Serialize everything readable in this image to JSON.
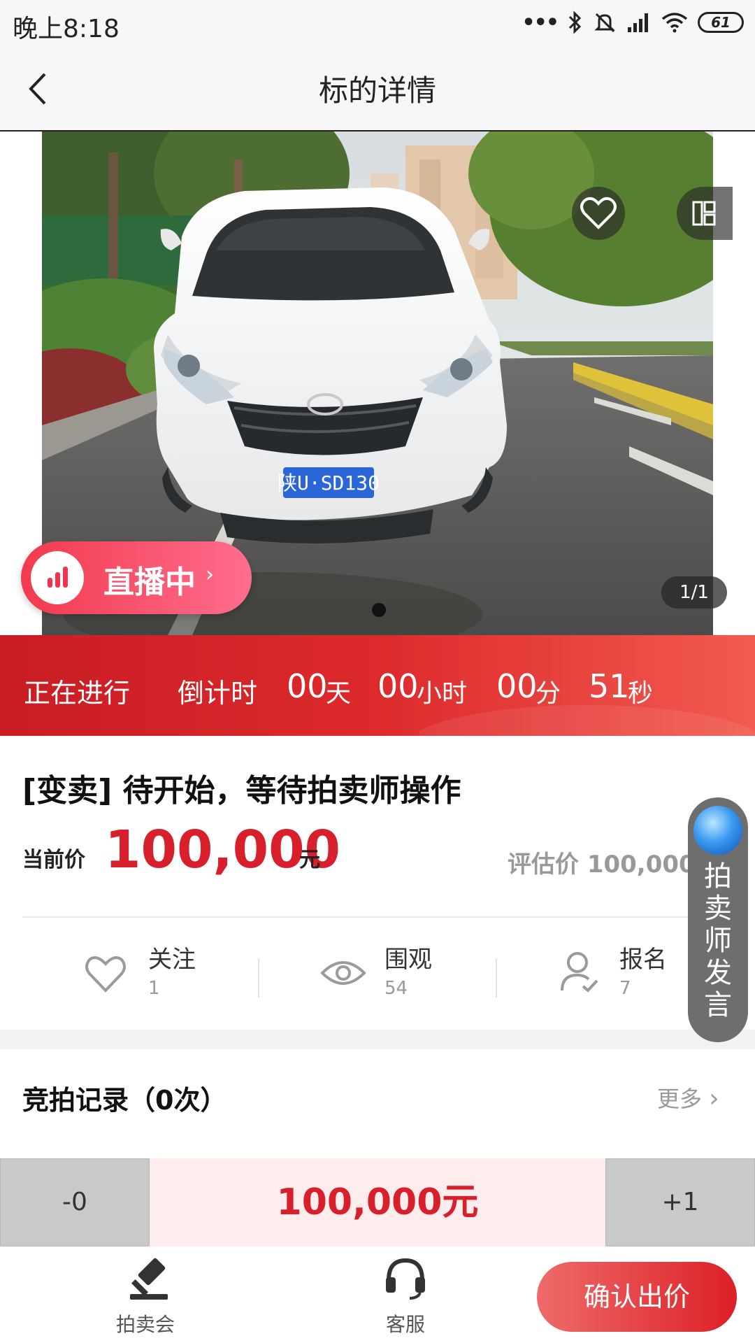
{
  "status_bar": {
    "time": "晚上8:18",
    "battery": "61"
  },
  "nav": {
    "title": "标的详情"
  },
  "gallery": {
    "live_label": "直播中",
    "page_counter": "1/1"
  },
  "countdown": {
    "status": "正在进行",
    "label": "倒计时",
    "days": "00",
    "days_unit": "天",
    "hours": "00",
    "hours_unit": "小时",
    "minutes": "00",
    "minutes_unit": "分",
    "seconds": "51",
    "seconds_unit": "秒"
  },
  "lot": {
    "title": "[变卖] 待开始，等待拍卖师操作",
    "price_label": "当前价",
    "price_value": "100,000",
    "price_unit": "元",
    "estimate": "评估价 100,000 元"
  },
  "stats": [
    {
      "label": "关注",
      "count": "1",
      "icon": "heart-icon"
    },
    {
      "label": "围观",
      "count": "54",
      "icon": "eye-icon"
    },
    {
      "label": "报名",
      "count": "7",
      "icon": "user-check-icon"
    }
  ],
  "auctioneer": {
    "label_lines": [
      "拍",
      "卖",
      "师",
      "发",
      "言"
    ]
  },
  "records": {
    "title": "竞拍记录（0次）",
    "more": "更多"
  },
  "stepper": {
    "minus": "-0",
    "value": "100,000元",
    "plus": "+1"
  },
  "bottom": {
    "tab_auction": "拍卖会",
    "tab_service": "客服",
    "confirm": "确认出价"
  },
  "colors": {
    "accent": "#d8202c",
    "live": "#f23a4d"
  }
}
